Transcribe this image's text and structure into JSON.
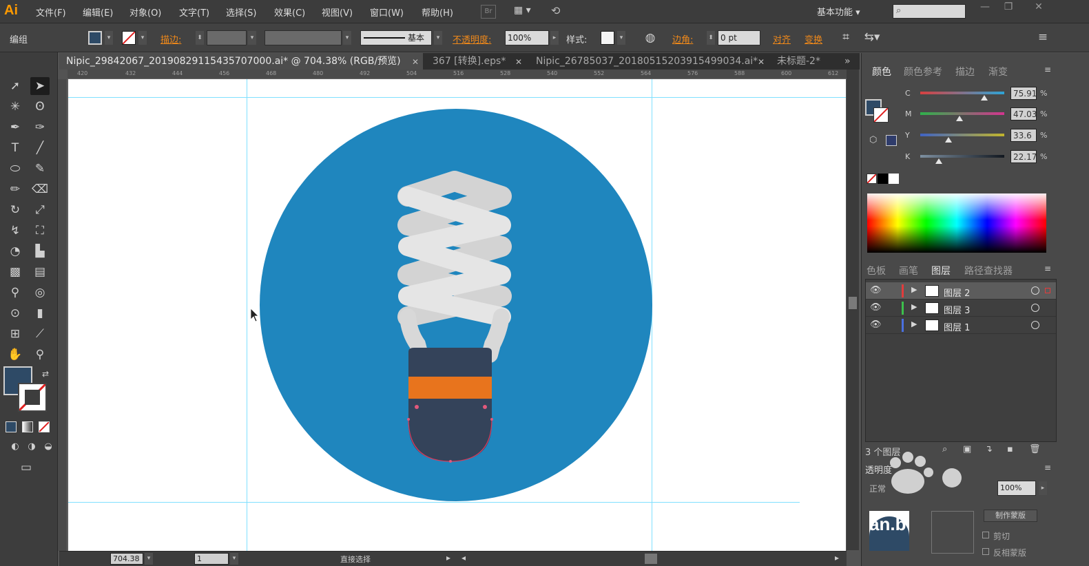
{
  "app": {
    "logo": "Ai",
    "menus": [
      "文件(F)",
      "编辑(E)",
      "对象(O)",
      "文字(T)",
      "选择(S)",
      "效果(C)",
      "视图(V)",
      "窗口(W)",
      "帮助(H)"
    ],
    "br_label": "Br",
    "workspace": "基本功能",
    "search_placeholder": ""
  },
  "control_bar": {
    "selection_label": "编组",
    "stroke_label": "描边:",
    "stroke_weight": "",
    "stroke_profile": "基本",
    "opacity_label": "不透明度:",
    "opacity_value": "100%",
    "style_label": "样式:",
    "corner_label": "边角:",
    "corner_value": "0 pt",
    "align_label": "对齐",
    "transform_label": "变换",
    "fill_color": "#2e4a66",
    "stroke_color": "none"
  },
  "tabs": [
    {
      "label": "Nipic_29842067_20190829115435707000.ai* @ 704.38% (RGB/预览)",
      "active": true
    },
    {
      "label": "367 [转换].eps*",
      "active": false
    },
    {
      "label": "Nipic_26785037_20180515203915499034.ai*",
      "active": false
    },
    {
      "label": "未标题-2*",
      "active": false
    }
  ],
  "rulers": {
    "top": [
      "420",
      "432",
      "444",
      "456",
      "468",
      "480",
      "492",
      "504",
      "516",
      "528",
      "540",
      "552",
      "564",
      "576",
      "588",
      "600",
      "612"
    ]
  },
  "statusbar": {
    "zoom": "704.38",
    "artboard": "1",
    "tool_name": "直接选择"
  },
  "color_panel": {
    "tabs": [
      "颜色",
      "颜色参考",
      "描边",
      "渐变"
    ],
    "channels": [
      {
        "label": "C",
        "value": "75.91",
        "level": 0.76,
        "colors": [
          "#d84040",
          "#2ea4d6"
        ]
      },
      {
        "label": "M",
        "value": "47.03",
        "level": 0.47,
        "colors": [
          "#2fb14b",
          "#d3348f"
        ]
      },
      {
        "label": "Y",
        "value": "33.6",
        "level": 0.34,
        "colors": [
          "#3f63c4",
          "#c2b52c"
        ]
      },
      {
        "label": "K",
        "value": "22.17",
        "level": 0.22,
        "colors": [
          "#7d8fa0",
          "#121820"
        ]
      }
    ],
    "pct": "%"
  },
  "layers_panel": {
    "tabs": [
      "色板",
      "画笔",
      "图层",
      "路径查找器"
    ],
    "layers": [
      {
        "name": "图层 2",
        "color": "#e23c3c",
        "selected": true
      },
      {
        "name": "图层 3",
        "color": "#3cc04c",
        "selected": false
      },
      {
        "name": "图层 1",
        "color": "#4a70e0",
        "selected": false
      }
    ],
    "count_label": "3 个图层"
  },
  "transparency_panel": {
    "title": "透明度",
    "mode": "正常",
    "opacity": "100%",
    "make_mask": "制作蒙版",
    "clip": "剪切",
    "invert": "反相蒙版"
  },
  "watermark": {
    "text": "an.b"
  },
  "artwork": {
    "circle_color": "#1f86be",
    "coil_color": "#e5e5e5",
    "coil_shadow": "#d3d3d3",
    "base_color": "#34435a",
    "band_color": "#e8741d"
  }
}
